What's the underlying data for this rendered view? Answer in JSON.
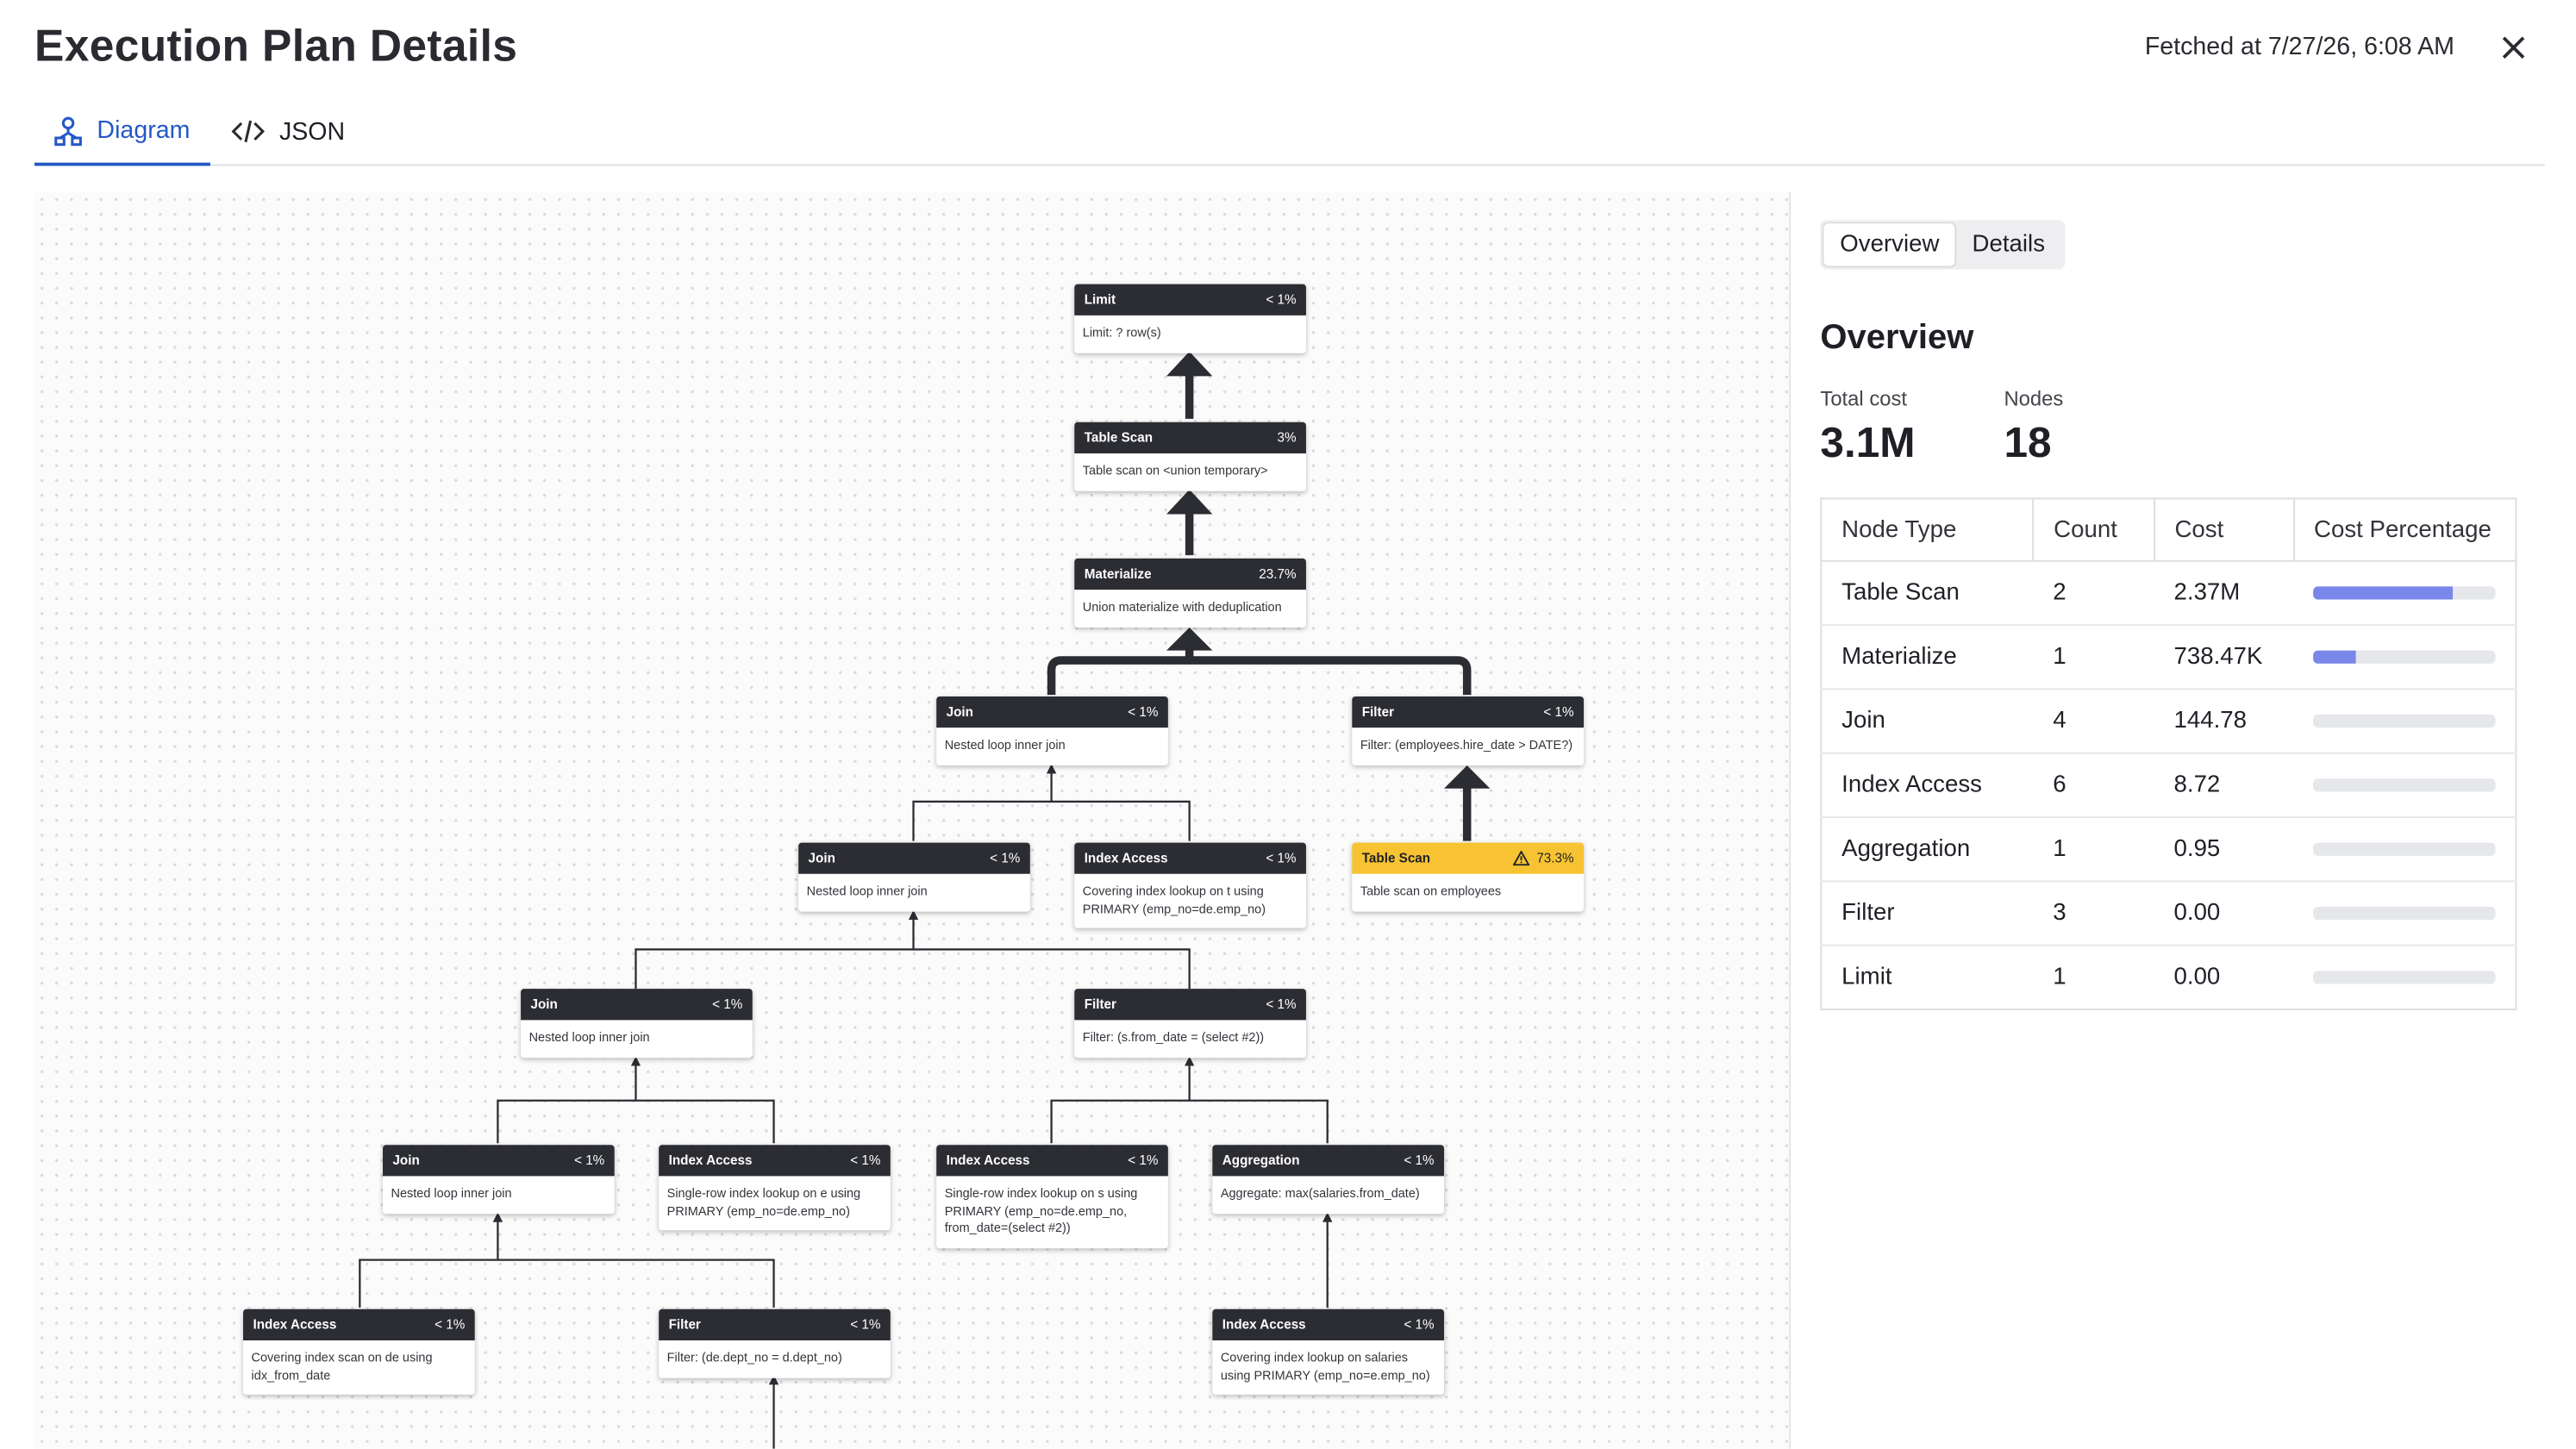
{
  "header": {
    "title": "Execution Plan Details",
    "fetched": "Fetched at 7/27/26, 6:08 AM"
  },
  "tabs": [
    {
      "label": "Diagram"
    },
    {
      "label": "JSON"
    }
  ],
  "nodes": [
    {
      "title": "Limit",
      "pct": "< 1%",
      "desc": "Limit: ? row(s)"
    },
    {
      "title": "Table Scan",
      "pct": "3%",
      "desc": "Table scan on <union temporary>"
    },
    {
      "title": "Materialize",
      "pct": "23.7%",
      "desc": "Union materialize with deduplication"
    },
    {
      "title": "Join",
      "pct": "< 1%",
      "desc": "Nested loop inner join"
    },
    {
      "title": "Filter",
      "pct": "< 1%",
      "desc": "Filter: (employees.hire_date > DATE?)"
    },
    {
      "title": "Join",
      "pct": "< 1%",
      "desc": "Nested loop inner join"
    },
    {
      "title": "Index Access",
      "pct": "< 1%",
      "desc": "Covering index lookup on t using PRIMARY (emp_no=de.emp_no)"
    },
    {
      "title": "Table Scan",
      "pct": "73.3%",
      "desc": "Table scan on employees",
      "warning": true
    },
    {
      "title": "Join",
      "pct": "< 1%",
      "desc": "Nested loop inner join"
    },
    {
      "title": "Filter",
      "pct": "< 1%",
      "desc": "Filter: (s.from_date = (select #2))"
    },
    {
      "title": "Join",
      "pct": "< 1%",
      "desc": "Nested loop inner join"
    },
    {
      "title": "Index Access",
      "pct": "< 1%",
      "desc": "Single-row index lookup on e using PRIMARY (emp_no=de.emp_no)"
    },
    {
      "title": "Index Access",
      "pct": "< 1%",
      "desc": "Single-row index lookup on s using PRIMARY (emp_no=de.emp_no, from_date=(select #2))"
    },
    {
      "title": "Aggregation",
      "pct": "< 1%",
      "desc": "Aggregate: max(salaries.from_date)"
    },
    {
      "title": "Index Access",
      "pct": "< 1%",
      "desc": "Covering index scan on de using idx_from_date"
    },
    {
      "title": "Filter",
      "pct": "< 1%",
      "desc": "Filter: (de.dept_no = d.dept_no)"
    },
    {
      "title": "Index Access",
      "pct": "< 1%",
      "desc": "Covering index lookup on salaries using PRIMARY (emp_no=e.emp_no)"
    }
  ],
  "side": {
    "seg": [
      {
        "label": "Overview"
      },
      {
        "label": "Details"
      }
    ],
    "heading": "Overview",
    "stats": {
      "total_label": "Total cost",
      "total_value": "3.1M",
      "nodes_label": "Nodes",
      "nodes_value": "18"
    },
    "table": {
      "headers": [
        "Node Type",
        "Count",
        "Cost",
        "Cost Percentage"
      ],
      "rows": [
        {
          "type": "Table Scan",
          "count": "2",
          "cost": "2.37M",
          "pct": 76.3
        },
        {
          "type": "Materialize",
          "count": "1",
          "cost": "738.47K",
          "pct": 23.7
        },
        {
          "type": "Join",
          "count": "4",
          "cost": "144.78",
          "pct": 0
        },
        {
          "type": "Index Access",
          "count": "6",
          "cost": "8.72",
          "pct": 0
        },
        {
          "type": "Aggregation",
          "count": "1",
          "cost": "0.95",
          "pct": 0
        },
        {
          "type": "Filter",
          "count": "3",
          "cost": "0.00",
          "pct": 0
        },
        {
          "type": "Limit",
          "count": "1",
          "cost": "0.00",
          "pct": 0
        }
      ]
    }
  },
  "colors": {
    "accent": "#2458c6",
    "node_header": "#2c2d33",
    "warning": "#f7c333",
    "bar": "#7b86ea"
  },
  "icons": {
    "diagram": "diagram-icon",
    "json": "code-icon",
    "close": "close-icon",
    "warning": "warning-icon"
  }
}
